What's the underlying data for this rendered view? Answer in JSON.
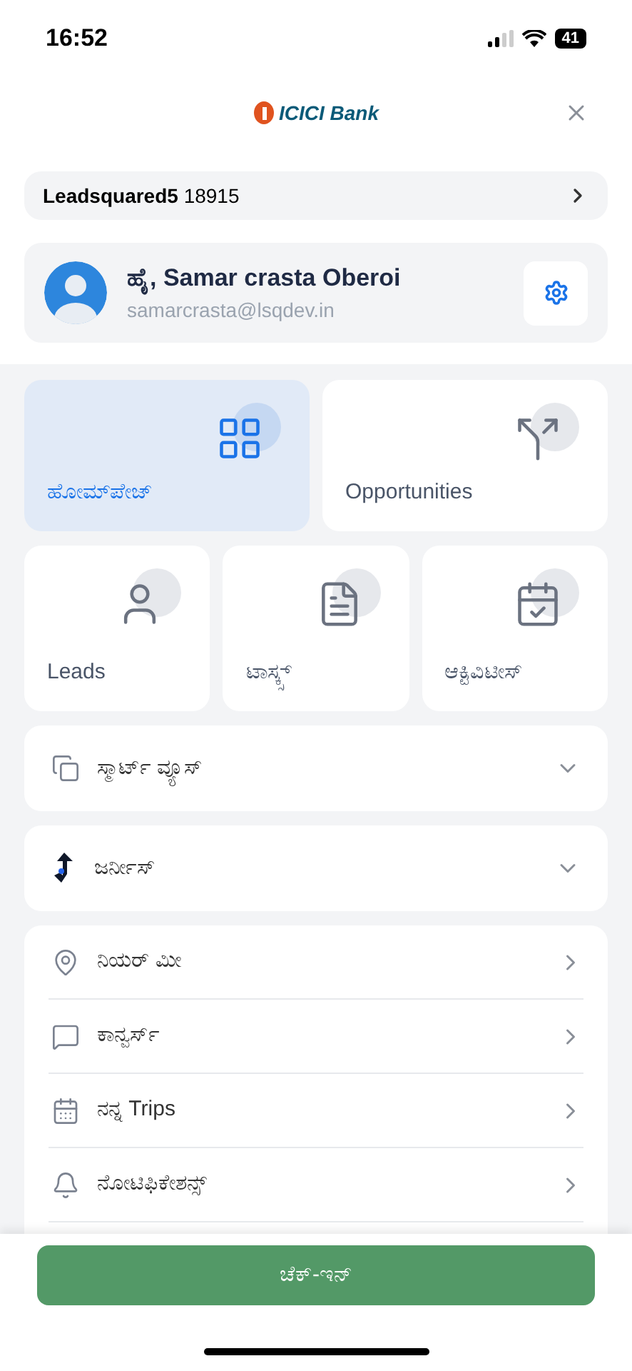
{
  "status_bar": {
    "time": "16:52",
    "battery": "41"
  },
  "header": {
    "logo_text": "ICICI Bank"
  },
  "account": {
    "name": "Leadsquared5",
    "id": "18915"
  },
  "profile": {
    "greeting": "ಹೈ, Samar crasta Oberoi",
    "email": "samarcrasta@lsqdev.in"
  },
  "tiles": [
    {
      "label": "ಹೋಮ್‌ಪೇಜ್",
      "selected": true
    },
    {
      "label": "Opportunities",
      "selected": false
    },
    {
      "label": "Leads",
      "selected": false
    },
    {
      "label": "ಟಾಸ್ಕ್ಸ್",
      "selected": false
    },
    {
      "label": "ಆಕ್ಟಿವಿಟೀಸ್",
      "selected": false
    }
  ],
  "sections": [
    {
      "label": "ಸ್ಮಾರ್ಟ್ ವ್ಯೂಸ್",
      "expanded": false
    },
    {
      "label": "ಜರ್ನೀಸ್",
      "expanded": false
    }
  ],
  "menu": [
    {
      "label": "ನಿಯರ್ ಮೀ"
    },
    {
      "label": "ಕಾನ್ವರ್ಸ್"
    },
    {
      "label": "ನನ್ನ Trips"
    },
    {
      "label": "ನೋಟಿಫಿಕೇಶನ್ಸ್"
    }
  ],
  "check_in_button": "ಚೆಕ್-ಇನ್"
}
